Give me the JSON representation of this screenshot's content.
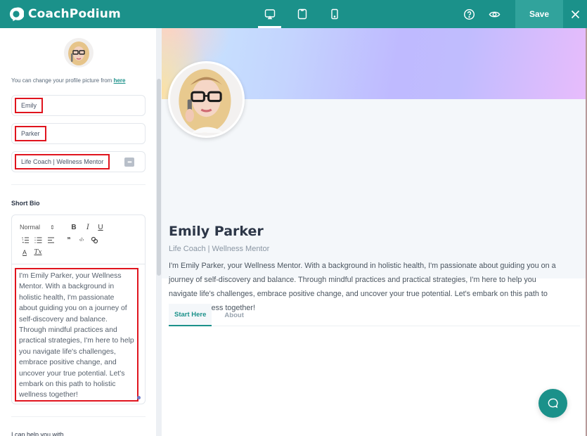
{
  "app": {
    "brand_name": "CoachPodium",
    "accent_color": "#1b918a"
  },
  "topbar": {
    "device_tabs": [
      {
        "name": "desktop",
        "icon": "desktop-icon",
        "active": true
      },
      {
        "name": "tablet",
        "icon": "tablet-icon",
        "active": false
      },
      {
        "name": "mobile",
        "icon": "mobile-icon",
        "active": false
      }
    ],
    "help_icon": "help-circle-icon",
    "preview_icon": "eye-icon",
    "save_label": "Save",
    "close_icon": "close-icon"
  },
  "sidebar": {
    "profile_hint": "You can change your profile picture from ",
    "profile_hint_link": "here",
    "first_name": "Emily",
    "last_name": "Parker",
    "headline": "Life Coach | Wellness Mentor",
    "headline_more_icon": "more-icon",
    "short_bio_label": "Short Bio",
    "editor": {
      "format_select": "Normal",
      "toolbar_buttons": [
        "bold",
        "italic",
        "underline",
        "ordered-list",
        "bullet-list",
        "align",
        "blockquote",
        "code",
        "link",
        "text-color",
        "clear-format"
      ],
      "bold_glyph": "B",
      "italic_glyph": "I",
      "underline_glyph": "U",
      "color_glyph": "A",
      "clear_glyph": "Tx",
      "content": "I'm Emily Parker, your Wellness Mentor. With a background in holistic health, I'm passionate about guiding you on a journey of self-discovery and balance. Through mindful practices and practical strategies, I'm here to help you navigate life's challenges, embrace positive change, and uncover your true potential. Let's embark on this path to holistic wellness together!"
    },
    "next_section_label": "I can help you with"
  },
  "preview": {
    "name": "Emily Parker",
    "title": "Life Coach | Wellness Mentor",
    "bio": "I'm Emily Parker, your Wellness Mentor. With a background in holistic health, I'm passionate about guiding you on a journey of self-discovery and balance. Through mindful practices and practical strategies, I'm here to help you navigate life's challenges, embrace positive change, and uncover your true potential. Let's embark on this path to holistic wellness together!",
    "tabs": [
      {
        "label": "Start Here",
        "active": true
      },
      {
        "label": "About",
        "active": false
      }
    ],
    "chat_icon": "chat-icon"
  }
}
